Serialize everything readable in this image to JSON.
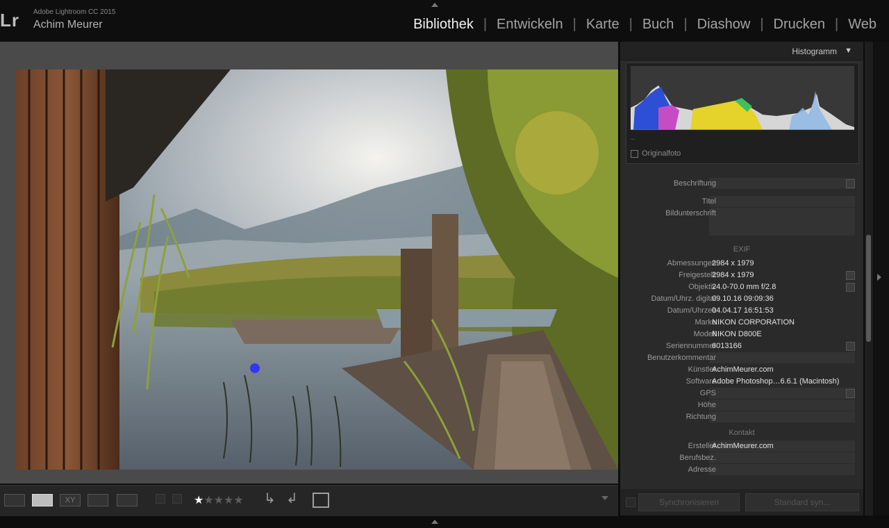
{
  "app": {
    "logo": "Lr",
    "product": "Adobe Lightroom CC 2015",
    "user": "Achim Meurer"
  },
  "modules": [
    {
      "label": "Bibliothek",
      "active": true
    },
    {
      "label": "Entwickeln",
      "active": false
    },
    {
      "label": "Karte",
      "active": false
    },
    {
      "label": "Buch",
      "active": false
    },
    {
      "label": "Diashow",
      "active": false
    },
    {
      "label": "Drucken",
      "active": false
    },
    {
      "label": "Web",
      "active": false
    }
  ],
  "histogram": {
    "title": "Histogramm",
    "original_label": "Originalfoto"
  },
  "metadata": {
    "caption_rows": [
      {
        "label": "Beschriftung",
        "value": ""
      },
      {
        "label": "Titel",
        "value": ""
      },
      {
        "label": "Bildunterschrift",
        "value": ""
      }
    ],
    "exif_title": "EXIF",
    "exif_rows": [
      {
        "label": "Abmessungen",
        "value": "2984 x 1979"
      },
      {
        "label": "Freigestellt",
        "value": "2984 x 1979"
      },
      {
        "label": "Objektiv",
        "value": "24.0-70.0 mm f/2.8"
      },
      {
        "label": "Datum/Uhrz. digital",
        "value": "09.10.16 09:09:36"
      },
      {
        "label": "Datum/Uhrzeit",
        "value": "04.04.17 16:51:53"
      },
      {
        "label": "Marke",
        "value": "NIKON CORPORATION"
      },
      {
        "label": "Modell",
        "value": "NIKON D800E"
      },
      {
        "label": "Seriennummer",
        "value": "6013166"
      },
      {
        "label": "Benutzerkommentar",
        "value": ""
      },
      {
        "label": "Künstler",
        "value": "AchimMeurer.com"
      },
      {
        "label": "Software",
        "value": "Adobe Photoshop…6.6.1 (Macintosh)"
      },
      {
        "label": "GPS",
        "value": ""
      },
      {
        "label": "Höhe",
        "value": ""
      },
      {
        "label": "Richtung",
        "value": ""
      }
    ],
    "contact_title": "Kontakt",
    "contact_rows": [
      {
        "label": "Ersteller",
        "value": "AchimMeurer.com"
      },
      {
        "label": "Berufsbez.",
        "value": ""
      },
      {
        "label": "Adresse",
        "value": ""
      }
    ]
  },
  "toolbar": {
    "rating_filled": 1,
    "rating_max": 5
  },
  "panel_buttons": {
    "sync": "Synchronisieren",
    "default": "Standard syn..."
  },
  "colors": {
    "accent_active": "#f2f2f2",
    "panel_bg": "#2a2a2a",
    "view_bg": "#4a4a4a"
  }
}
